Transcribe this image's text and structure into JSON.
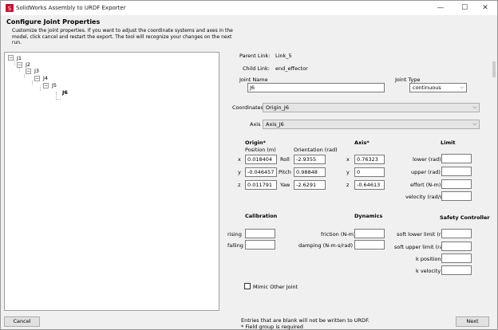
{
  "window": {
    "title": "SolidWorks Assembly to URDF Exporter",
    "minimize": "—",
    "maximize": "☐",
    "close": "✕"
  },
  "header": {
    "title": "Configure Joint Properties",
    "description": "Customize the joint properties. If you want to adjust the coordinate systems and axes in the model, click cancel and restart the export. The tool will recognize your changes on the next run."
  },
  "tree": {
    "nodes": [
      {
        "label": "J1",
        "toggle": "−"
      },
      {
        "label": "J2",
        "toggle": "−"
      },
      {
        "label": "J3",
        "toggle": "−"
      },
      {
        "label": "J4",
        "toggle": "−"
      },
      {
        "label": "J5",
        "toggle": "−"
      },
      {
        "label": "J6",
        "toggle": ""
      }
    ]
  },
  "links": {
    "parent_label": "Parent Link:",
    "parent_value": "Link_5",
    "child_label": "Child Link:",
    "child_value": "end_effector"
  },
  "joint": {
    "name_label": "Joint Name",
    "name_value": "J6",
    "type_label": "Joint Type",
    "type_value": "continuous"
  },
  "coordinates": {
    "label": "Coordinates",
    "value": "Origin_J6"
  },
  "axis_select": {
    "label": "Axis",
    "value": "Axis_J6"
  },
  "origin": {
    "title": "Origin*",
    "position_label": "Position (m)",
    "orientation_label": "Orientation (rad)",
    "x_label": "x",
    "y_label": "y",
    "z_label": "z",
    "x": "0.018404",
    "y": "-0.046457",
    "z": "0.011791",
    "roll_label": "Roll",
    "pitch_label": "Pitch",
    "yaw_label": "Yaw",
    "roll": "-2.9355",
    "pitch": "0.98848",
    "yaw": "-2.6291"
  },
  "axis": {
    "title": "Axis*",
    "x_label": "x",
    "y_label": "y",
    "z_label": "z",
    "x": "0.76323",
    "y": "0",
    "z": "-0.64613"
  },
  "limit": {
    "title": "Limit",
    "lower_label": "lower (rad)",
    "upper_label": "upper (rad)",
    "effort_label": "effort (N-m)",
    "velocity_label": "velocity (rad/s)",
    "lower": "",
    "upper": "",
    "effort": "",
    "velocity": ""
  },
  "calibration": {
    "title": "Calibration",
    "rising_label": "rising",
    "falling_label": "falling",
    "rising": "",
    "falling": ""
  },
  "dynamics": {
    "title": "Dynamics",
    "friction_label": "friction (N-m)",
    "damping_label": "damping (N-m-s/rad)",
    "friction": "",
    "damping": ""
  },
  "safety": {
    "title": "Safety Controller",
    "soft_lower_label": "soft lower limit (rad)",
    "soft_upper_label": "soft upper limit (rad)",
    "k_position_label": "k position",
    "k_velocity_label": "k velocity",
    "soft_lower": "",
    "soft_upper": "",
    "k_position": "",
    "k_velocity": ""
  },
  "mimic": {
    "label": "Mimic Other Joint"
  },
  "footer": {
    "note1": "Entries that are blank will not be written to URDF.",
    "note2": "* Field group is required",
    "cancel": "Cancel",
    "next": "Next"
  }
}
